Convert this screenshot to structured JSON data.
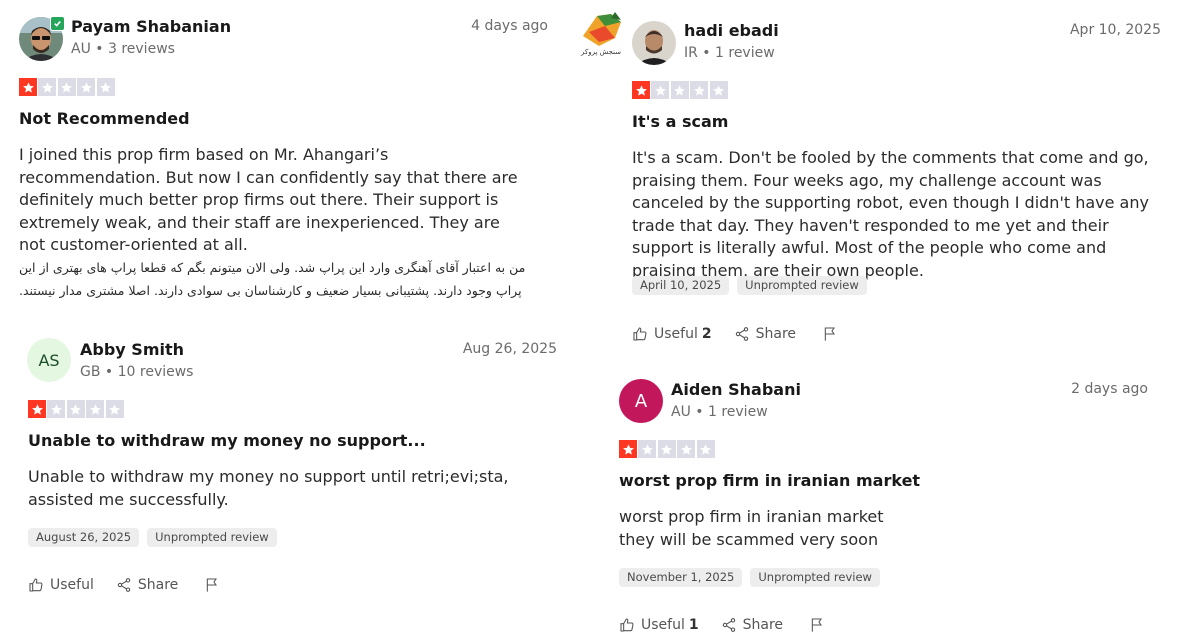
{
  "colors": {
    "star_on": "#ff3722",
    "star_off": "#dcdce6",
    "tag_bg": "#ededed",
    "verified": "#26a65b"
  },
  "reviews": [
    {
      "reviewer": "Payam Shabanian",
      "meta": "AU • 3 reviews",
      "date": "4 days ago",
      "rating": 1,
      "title": "Not Recommended",
      "body": "I joined this prop firm based on Mr. Ahangari’s recommendation. But now I can confidently say that there are definitely much better prop firms out there. Their support is extremely weak, and their staff are inexperienced. They are not customer-oriented at all.",
      "body_fa": "من به اعتبار آقای آهنگری وارد این پراپ شد. ولی الان میتونم بگم که قطعا پراپ های بهتری از این پراپ وجود دارند. پشتیبانی بسیار ضعیف و کارشناسان بی سوادی دارند. اصلا مشتری مدار نیستند."
    },
    {
      "reviewer": "hadi ebadi",
      "meta": "IR • 1 review",
      "date": "Apr 10, 2025",
      "rating": 1,
      "title": "It's a scam",
      "body": "It's a scam. Don't be fooled by the comments that come and go, praising them. Four weeks ago, my challenge account was canceled by the supporting robot, even though I didn't have any trade that day. They haven't responded to me yet and their support is literally awful. Most of the people who come and praising them, are their own people.",
      "experience_date": "April 10, 2025",
      "tag": "Unprompted review",
      "useful_label": "Useful",
      "useful_count": "2",
      "share_label": "Share",
      "logo_text": "سنجش پروکر"
    },
    {
      "reviewer": "Abby Smith",
      "initials": "AS",
      "meta": "GB • 10 reviews",
      "date": "Aug 26, 2025",
      "rating": 1,
      "title": "Unable to withdraw my money no support...",
      "body": "Unable to withdraw my money no support until retri;evi;sta, assisted me successfully.",
      "experience_date": "August 26, 2025",
      "tag": "Unprompted review",
      "useful_label": "Useful",
      "share_label": "Share"
    },
    {
      "reviewer": "Aiden Shabani",
      "initials": "A",
      "meta": "AU • 1 review",
      "date": "2 days ago",
      "rating": 1,
      "title": "worst prop firm in iranian market",
      "body_line1": "worst prop firm in iranian market",
      "body_line2": "they will be scammed very soon",
      "experience_date": "November 1, 2025",
      "tag": "Unprompted review",
      "useful_label": "Useful",
      "useful_count": "1",
      "share_label": "Share"
    }
  ]
}
